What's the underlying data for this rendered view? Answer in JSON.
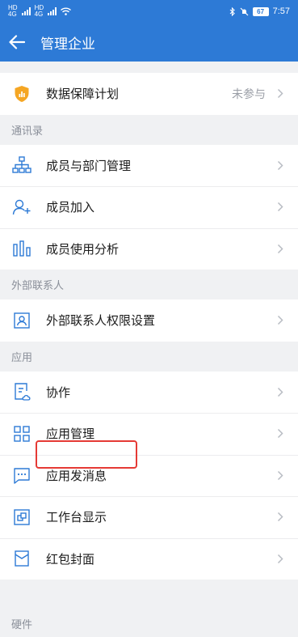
{
  "status_bar": {
    "left_a": "HD",
    "left_a2": "4G",
    "left_b": "HD",
    "left_b2": "4G",
    "time": "7:57",
    "battery": "67"
  },
  "nav": {
    "title": "管理企业"
  },
  "top_group": {
    "item": {
      "label": "数据保障计划",
      "value": "未参与"
    }
  },
  "contacts": {
    "header": "通讯录",
    "items": [
      {
        "label": "成员与部门管理",
        "icon": "org-chart-icon"
      },
      {
        "label": "成员加入",
        "icon": "add-user-icon"
      },
      {
        "label": "成员使用分析",
        "icon": "bar-chart-icon"
      }
    ]
  },
  "external": {
    "header": "外部联系人",
    "items": [
      {
        "label": "外部联系人权限设置",
        "icon": "contact-card-icon"
      }
    ]
  },
  "apps": {
    "header": "应用",
    "items": [
      {
        "label": "协作",
        "icon": "document-cloud-icon"
      },
      {
        "label": "应用管理",
        "icon": "grid-icon"
      },
      {
        "label": "应用发消息",
        "icon": "message-icon"
      },
      {
        "label": "工作台显示",
        "icon": "layers-icon"
      },
      {
        "label": "红包封面",
        "icon": "envelope-icon"
      }
    ]
  },
  "hardware": {
    "header": "硬件"
  },
  "colors": {
    "accent": "#2d7ad6",
    "shield": "#f5a623",
    "highlight": "#e53a35"
  }
}
